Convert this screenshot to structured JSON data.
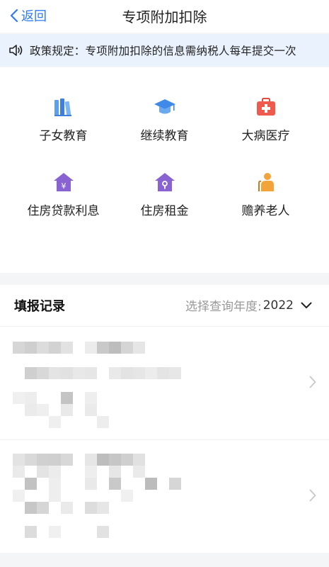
{
  "navbar": {
    "back_label": "返回",
    "title": "专项附加扣除"
  },
  "notice": {
    "icon": "speaker-icon",
    "text": "政策规定：专项附加扣除的信息需纳税人每年提交一次"
  },
  "deductions": [
    {
      "label": "子女教育",
      "icon": "books-icon"
    },
    {
      "label": "继续教育",
      "icon": "graduation-cap-icon"
    },
    {
      "label": "大病医疗",
      "icon": "medical-kit-icon"
    },
    {
      "label": "住房贷款利息",
      "icon": "house-yuan-icon"
    },
    {
      "label": "住房租金",
      "icon": "house-key-icon"
    },
    {
      "label": "赡养老人",
      "icon": "elderly-person-icon"
    }
  ],
  "records": {
    "title": "填报记录",
    "year_label": "选择查询年度:",
    "year_value": "2022"
  },
  "colors": {
    "accent": "#2f7bf6",
    "notice_bg": "#eaf2fd",
    "icon_blue": "#4a90e8",
    "icon_red": "#ef5a4f",
    "icon_purple": "#8a63d2",
    "icon_orange": "#f2a33a"
  }
}
